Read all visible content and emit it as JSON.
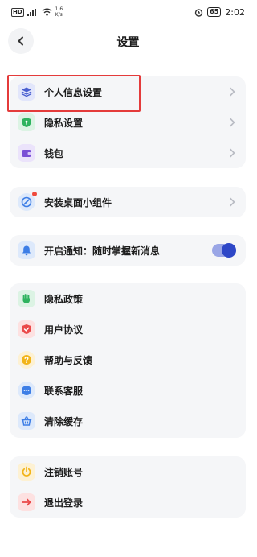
{
  "status_bar": {
    "network_badge": "HD",
    "signal": "4G",
    "speed_value": "1.6",
    "speed_unit": "K/s",
    "battery": "65",
    "time": "2:02"
  },
  "header": {
    "title": "设置"
  },
  "group1": {
    "items": [
      {
        "label": "个人信息设置",
        "icon": "layers-icon"
      },
      {
        "label": "隐私设置",
        "icon": "shield-icon"
      },
      {
        "label": "钱包",
        "icon": "wallet-icon"
      }
    ]
  },
  "group2": {
    "items": [
      {
        "label": "安装桌面小组件",
        "icon": "widget-icon"
      }
    ]
  },
  "group3": {
    "items": [
      {
        "label": "开启通知：随时掌握新消息",
        "icon": "bell-icon",
        "toggle_on": true
      }
    ]
  },
  "group4": {
    "items": [
      {
        "label": "隐私政策",
        "icon": "hand-icon"
      },
      {
        "label": "用户协议",
        "icon": "shield-check-icon"
      },
      {
        "label": "帮助与反馈",
        "icon": "help-icon"
      },
      {
        "label": "联系客服",
        "icon": "chat-icon"
      },
      {
        "label": "清除缓存",
        "icon": "basket-icon"
      }
    ]
  },
  "group5": {
    "items": [
      {
        "label": "注销账号",
        "icon": "power-icon"
      },
      {
        "label": "退出登录",
        "icon": "logout-arrow-icon"
      }
    ]
  },
  "colors": {
    "card_bg": "#f5f6f8",
    "accent_blue": "#2e47c7",
    "highlight_red": "#e43b3b"
  }
}
